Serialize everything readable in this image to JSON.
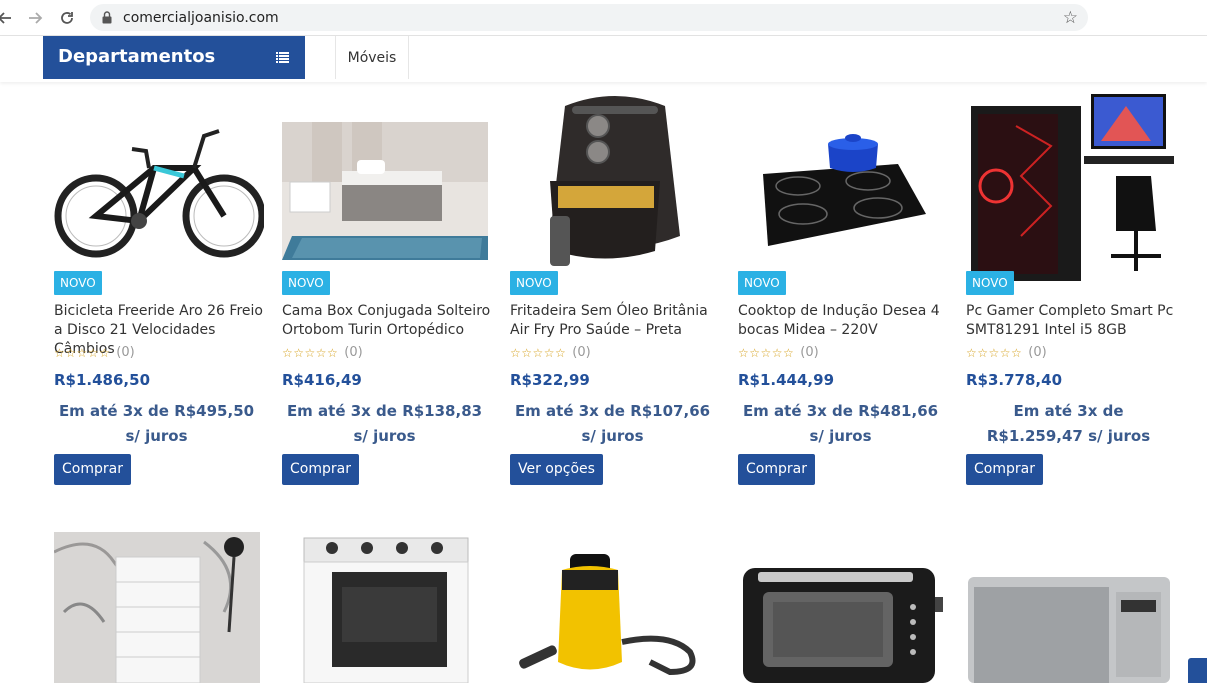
{
  "browser": {
    "url": "comercialjoanisio.com",
    "icons": [
      "back-icon",
      "forward-icon",
      "reload-icon",
      "lock-icon",
      "star-icon"
    ]
  },
  "header": {
    "departments_label": "Departamentos",
    "menu_items": [
      "Móveis"
    ]
  },
  "products": [
    {
      "badge": "NOVO",
      "title": "Bicicleta Freeride Aro 26 Freio a Disco 21 Velocidades Câmbios",
      "review_count": "(0)",
      "price": "R$1.486,50",
      "installment": "Em até 3x de R$495,50 s/ juros",
      "button": "Comprar"
    },
    {
      "badge": "NOVO",
      "title": "Cama Box Conjugada Solteiro Ortobom Turin Ortopédico",
      "review_count": "(0)",
      "price": "R$416,49",
      "installment": "Em até 3x de R$138,83 s/ juros",
      "button": "Comprar"
    },
    {
      "badge": "NOVO",
      "title": "Fritadeira Sem Óleo Britânia Air Fry Pro Saúde – Preta",
      "review_count": "(0)",
      "price": "R$322,99",
      "installment": "Em até 3x de R$107,66 s/ juros",
      "button": "Ver opções"
    },
    {
      "badge": "NOVO",
      "title": "Cooktop de Indução Desea 4 bocas Midea – 220V",
      "review_count": "(0)",
      "price": "R$1.444,99",
      "installment": "Em até 3x de R$481,66 s/ juros",
      "button": "Comprar"
    },
    {
      "badge": "NOVO",
      "title": "Pc Gamer Completo Smart Pc SMT81291 Intel i5 8GB",
      "review_count": "(0)",
      "price": "R$3.778,40",
      "installment": "Em até 3x de R$1.259,47 s/ juros",
      "button": "Comprar"
    }
  ],
  "second_row_products": [
    "chest-of-drawers",
    "stove",
    "vacuum-cleaner",
    "toaster",
    "microwave"
  ],
  "colors": {
    "primary": "#23509a",
    "badge": "#2bb1e4",
    "stars": "#d6a21e"
  }
}
